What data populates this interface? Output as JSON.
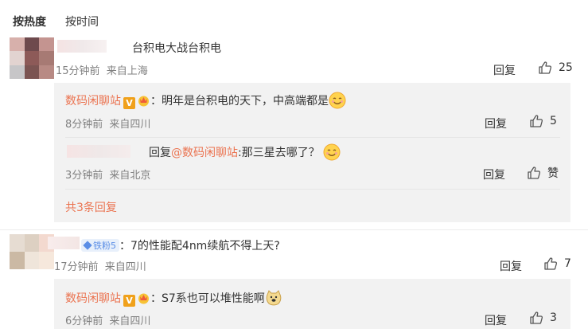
{
  "sort": {
    "hot": "按热度",
    "time": "按时间"
  },
  "comments": [
    {
      "text": "台积电大战台积电",
      "time": "15分钟前",
      "location": "来自上海",
      "reply": "回复",
      "likes": "25",
      "replies": [
        {
          "user": "数码闲聊站",
          "text": "：明年是台积电的天下，中高端都是",
          "time": "8分钟前",
          "location": "来自四川",
          "reply": "回复",
          "likes": "5"
        },
        {
          "prefix": "回复",
          "mention": "@数码闲聊站",
          "text": ":那三星去哪了？",
          "time": "3分钟前",
          "location": "来自北京",
          "reply": "回复",
          "likes": "赞"
        }
      ],
      "more": "共3条回复"
    },
    {
      "badge": "铁粉5",
      "text": "：7的性能配4nm续航不得上天?",
      "time": "17分钟前",
      "location": "来自四川",
      "reply": "回复",
      "likes": "7",
      "replies": [
        {
          "user": "数码闲聊站",
          "text": "：S7系也可以堆性能啊",
          "time": "6分钟前",
          "location": "来自四川",
          "reply": "回复",
          "likes": "3"
        }
      ]
    }
  ],
  "colors": {
    "username": "#eb7350",
    "meta": "#808080",
    "reply_bg": "#f2f2f2"
  }
}
